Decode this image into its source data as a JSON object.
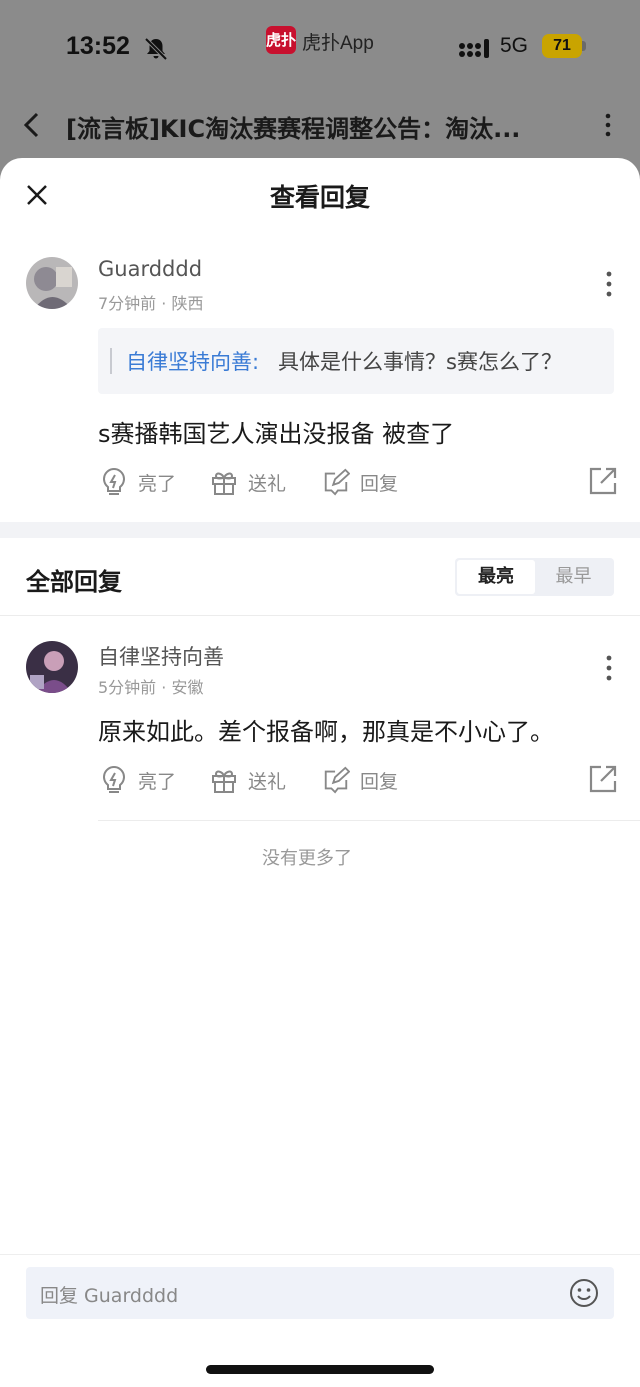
{
  "status_bar": {
    "time": "13:52",
    "app_name": "虎扑App",
    "app_badge": "虎扑",
    "network": "5G",
    "battery": "71"
  },
  "nav": {
    "title": "[流言板]KIC淘汰赛赛程调整公告：淘汰..."
  },
  "sheet": {
    "title": "查看回复"
  },
  "main_post": {
    "user": "Guardddd",
    "meta": "7分钟前 · 陕西",
    "quote_user": "自律坚持向善:",
    "quote_text": "具体是什么事情？s赛怎么了？",
    "content": "s赛播韩国艺人演出没报备 被查了",
    "actions": {
      "like": "亮了",
      "gift": "送礼",
      "reply": "回复"
    }
  },
  "replies_section": {
    "title": "全部回复",
    "sort_active": "最亮",
    "sort_other": "最早"
  },
  "replies": [
    {
      "user": "自律坚持向善",
      "meta": "5分钟前 · 安徽",
      "content": "原来如此。差个报备啊，那真是不小心了。",
      "actions": {
        "like": "亮了",
        "gift": "送礼",
        "reply": "回复"
      }
    }
  ],
  "footer": {
    "no_more": "没有更多了",
    "reply_placeholder": "回复 Guardddd"
  },
  "colors": {
    "link_blue": "#3a7bd5",
    "brand_red": "#c8102e",
    "input_bg": "#eff2f9"
  }
}
